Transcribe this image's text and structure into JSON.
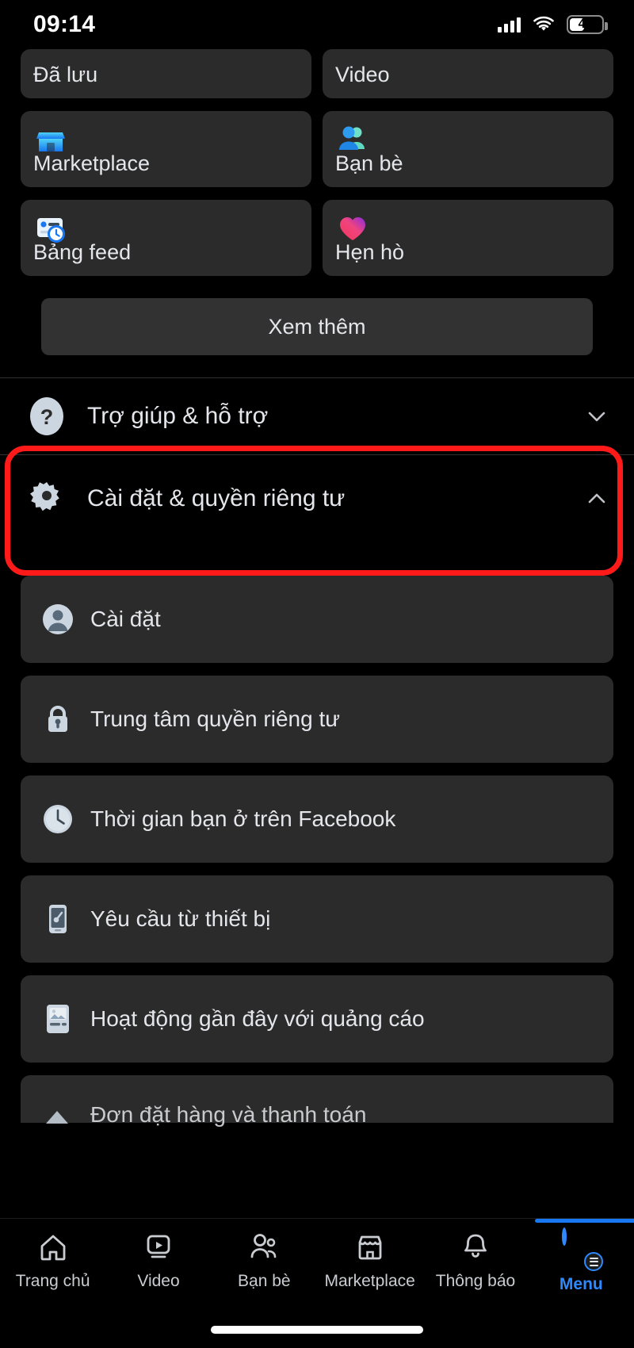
{
  "status_bar": {
    "time": "09:14",
    "battery_percent": "47",
    "signal_icon": "cellular-signal-icon",
    "wifi_icon": "wifi-icon",
    "battery_icon": "battery-icon"
  },
  "shortcuts": {
    "tiles": [
      {
        "label": "Đã lưu",
        "icon": "saved-icon",
        "clipped": true
      },
      {
        "label": "Video",
        "icon": "video-icon",
        "clipped": true
      },
      {
        "label": "Marketplace",
        "icon": "marketplace-storefront-icon",
        "clipped": false
      },
      {
        "label": "Bạn bè",
        "icon": "friends-people-icon",
        "clipped": false
      },
      {
        "label": "Bảng feed",
        "icon": "feeds-board-icon",
        "clipped": false
      },
      {
        "label": "Hẹn hò",
        "icon": "dating-heart-icon",
        "clipped": false
      }
    ],
    "see_more_label": "Xem thêm"
  },
  "accordions": {
    "help": {
      "label": "Trợ giúp & hỗ trợ",
      "icon": "question-mark-icon",
      "chevron": "chevron-down-icon",
      "expanded": false
    },
    "settings": {
      "label": "Cài đặt & quyền riêng tư",
      "icon": "gear-icon",
      "chevron": "chevron-up-icon",
      "expanded": true,
      "highlighted": true,
      "highlight_color": "#ff1a1a"
    }
  },
  "settings_items": [
    {
      "label": "Cài đặt",
      "icon": "account-person-icon",
      "clipped": false
    },
    {
      "label": "Trung tâm quyền riêng tư",
      "icon": "lock-icon",
      "clipped": false
    },
    {
      "label": "Thời gian bạn ở trên Facebook",
      "icon": "clock-icon",
      "clipped": false
    },
    {
      "label": "Yêu cầu từ thiết bị",
      "icon": "mobile-device-key-icon",
      "clipped": false
    },
    {
      "label": "Hoạt động gần đây với quảng cáo",
      "icon": "ad-activity-icon",
      "clipped": false
    },
    {
      "label": "Đơn đặt hàng và thanh toán",
      "icon": "orders-payments-icon",
      "clipped": true
    }
  ],
  "tabbar": {
    "active_color": "#2e89ff",
    "indicator_color": "#1877f2",
    "tabs": [
      {
        "label": "Trang chủ",
        "icon": "home-icon",
        "active": false
      },
      {
        "label": "Video",
        "icon": "video-play-icon",
        "active": false
      },
      {
        "label": "Bạn bè",
        "icon": "friends-icon",
        "active": false
      },
      {
        "label": "Marketplace",
        "icon": "marketplace-icon",
        "active": false
      },
      {
        "label": "Thông báo",
        "icon": "bell-notification-icon",
        "active": false
      },
      {
        "label": "Menu",
        "icon": "profile-avatar-menu-icon",
        "active": true
      }
    ]
  }
}
